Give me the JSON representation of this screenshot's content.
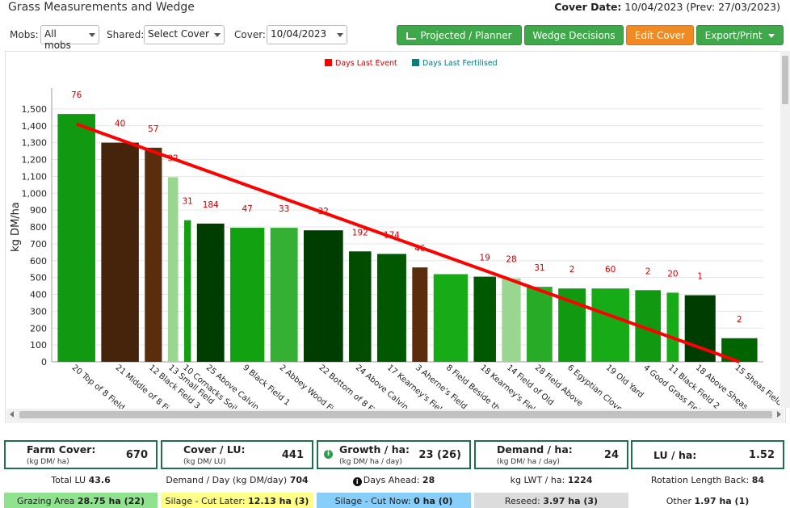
{
  "header": {
    "title": "Grass Measurements and Wedge",
    "cover_date_label": "Cover Date:",
    "cover_date_value": "10/04/2023 (Prev: 27/03/2023)"
  },
  "toolbar": {
    "mobs_label": "Mobs:",
    "mobs_value": "All mobs",
    "shared_label": "Shared:",
    "shared_value": "Select Cover",
    "cover_label": "Cover:",
    "cover_value": "10/04/2023",
    "projected_label": "Projected / Planner",
    "wedge_label": "Wedge Decisions",
    "edit_label": "Edit Cover",
    "export_label": "Export/Print"
  },
  "colors": {
    "button_green": "#3ea84a",
    "button_orange": "#f08a24",
    "card_border": "#1f6f4f",
    "wedge_line": "#ff0000",
    "label_red": "#cc0000",
    "grazing": "#8fe38f",
    "silage_later": "#ffff88",
    "silage_now": "#87cefa",
    "reseed": "#dcdcdc"
  },
  "chart_data": {
    "type": "bar",
    "ylabel": "kg DM/ha",
    "ylim": [
      0,
      1600
    ],
    "yticks": [
      0,
      100,
      200,
      300,
      400,
      500,
      600,
      700,
      800,
      900,
      1000,
      1100,
      1200,
      1300,
      1400,
      1500
    ],
    "legend": [
      {
        "name": "Days Last Event",
        "color": "#ff0000"
      },
      {
        "name": "Days Last Fertilised",
        "color": "#008080"
      }
    ],
    "legend_position": "top-center",
    "grid": true,
    "categories": [
      "20 Top of 8 Field",
      "21 Middle of 8 Field",
      "12 Black Field 3",
      "13 Small Field",
      "10 Cornacks Soil",
      "25 Above Calvin",
      "9 Black Field 1",
      "2 Abbey Wood Field",
      "22 Bottom of 8 Field",
      "24 Above Calvin",
      "17 Kearney's Field",
      "3 Aherne's Field",
      "8 Field Beside the",
      "18 Kearney's Field",
      "14 Field of Old",
      "28 Field Above",
      "6 Egyptian Clover",
      "19 Old Yard",
      "4 Good Grass Field",
      "11 Black Field 2",
      "18 Above Sheas",
      "15 Sheas Field"
    ],
    "values": [
      1470,
      1300,
      1270,
      1095,
      840,
      820,
      795,
      795,
      780,
      655,
      640,
      560,
      520,
      505,
      495,
      445,
      435,
      435,
      425,
      410,
      395,
      140
    ],
    "days_last_event": [
      "76",
      "40",
      "57",
      "32",
      "31",
      "184",
      "47",
      "33",
      "32",
      "192",
      "174",
      "46",
      "",
      "19",
      "28",
      "31",
      "2",
      "60",
      "2",
      "20",
      "1",
      "2"
    ],
    "bar_colors": [
      "#119911",
      "#46230b",
      "#5c2d0d",
      "#99d68f",
      "#12a012",
      "#003d00",
      "#11a111",
      "#35b035",
      "#003d00",
      "#004d00",
      "#005800",
      "#5c2d0d",
      "#17ab17",
      "#005800",
      "#99d68f",
      "#28ac28",
      "#119911",
      "#17ab17",
      "#119911",
      "#17ab17",
      "#003d00",
      "#006400"
    ],
    "wedge_line": {
      "start": 1410,
      "end": 0,
      "color": "#ff0000"
    }
  },
  "stats": {
    "farm_cover": {
      "title": "Farm Cover:",
      "sub": "(kg DM/ ha)",
      "value": "670"
    },
    "cover_lu": {
      "title": "Cover / LU:",
      "sub": "(kg DM/ LU)",
      "value": "441"
    },
    "growth": {
      "title": "Growth / ha:",
      "sub": "(kg DM/ ha / day)",
      "value": "23 (26)"
    },
    "demand": {
      "title": "Demand / ha:",
      "sub": "(kg DM/ ha / day)",
      "value": "24"
    },
    "lu_ha": {
      "title": "LU / ha:",
      "value": "1.52"
    }
  },
  "row2": {
    "total_lu_label": "Total LU",
    "total_lu_value": "43.6",
    "demand_day_label": "Demand / Day (kg DM/day)",
    "demand_day_value": "704",
    "days_ahead_label": "Days Ahead:",
    "days_ahead_value": "28",
    "kg_lwt_label": "kg LWT / ha:",
    "kg_lwt_value": "1224",
    "rotation_label": "Rotation Length Back:",
    "rotation_value": "84"
  },
  "row3": {
    "grazing_label": "Grazing Area",
    "grazing_value": "28.75 ha (22)",
    "silage_later_label": "Silage - Cut Later:",
    "silage_later_value": "12.13 ha (3)",
    "silage_now_label": "Silage - Cut Now:",
    "silage_now_value": "0 ha (0)",
    "reseed_label": "Reseed:",
    "reseed_value": "3.97 ha (3)",
    "other_label": "Other",
    "other_value": "1.97 ha (1)"
  }
}
